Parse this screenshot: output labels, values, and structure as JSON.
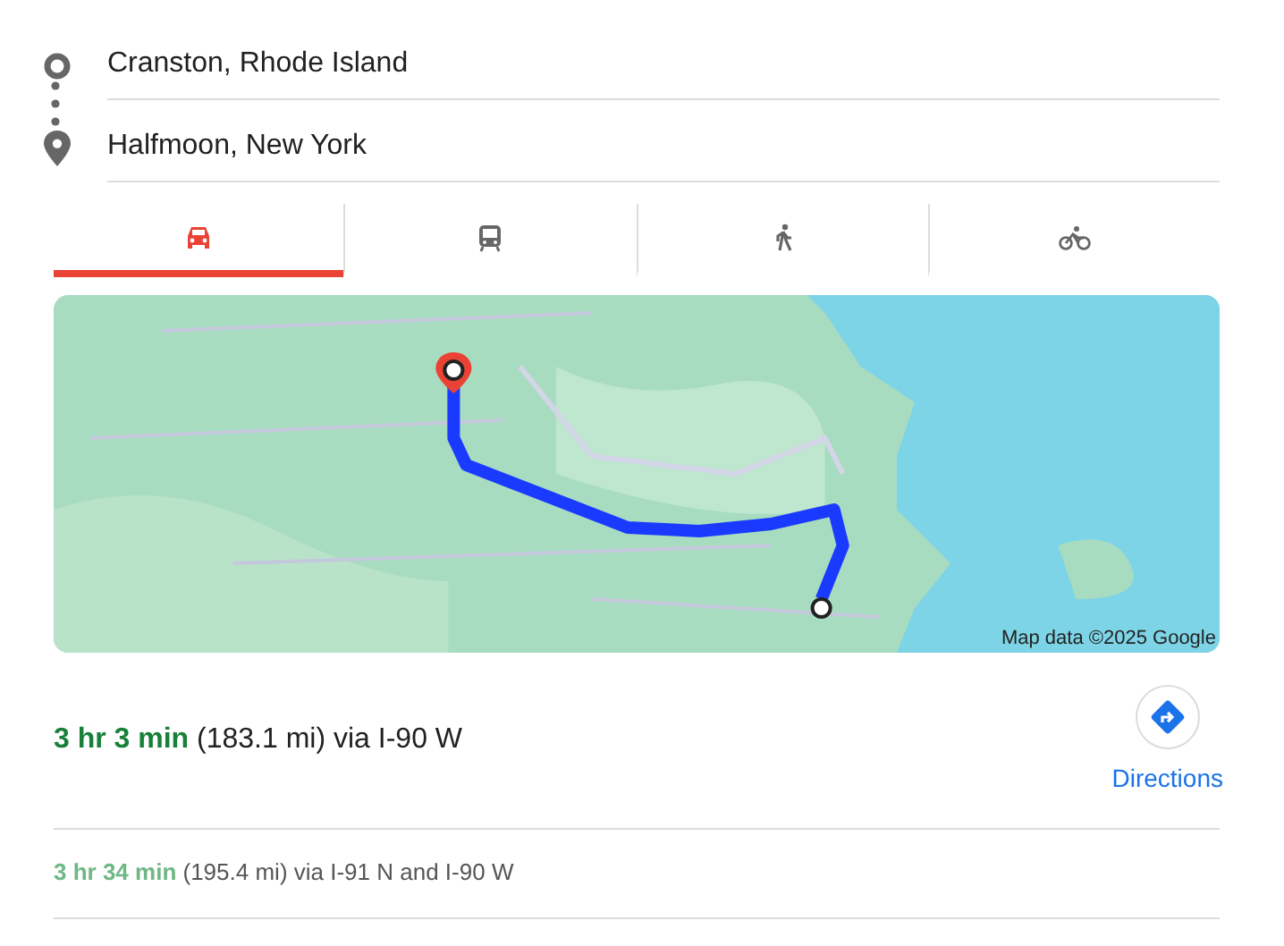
{
  "stops": [
    {
      "kind": "origin",
      "value": "Cranston, Rhode Island"
    },
    {
      "kind": "destination",
      "value": "Halfmoon, New York"
    }
  ],
  "travel_modes": [
    {
      "kind": "car",
      "selected": true
    },
    {
      "kind": "transit",
      "selected": false
    },
    {
      "kind": "walk",
      "selected": false
    },
    {
      "kind": "bike",
      "selected": false
    }
  ],
  "map": {
    "attribution": "Map data ©2025 Google"
  },
  "routes": [
    {
      "duration": "3 hr 3 min",
      "details": "(183.1 mi) via I-90 W",
      "selected": true
    },
    {
      "duration": "3 hr 34 min",
      "details": "(195.4 mi) via I-91 N and I-90 W",
      "selected": false
    }
  ],
  "directions_button": {
    "label": "Directions"
  }
}
